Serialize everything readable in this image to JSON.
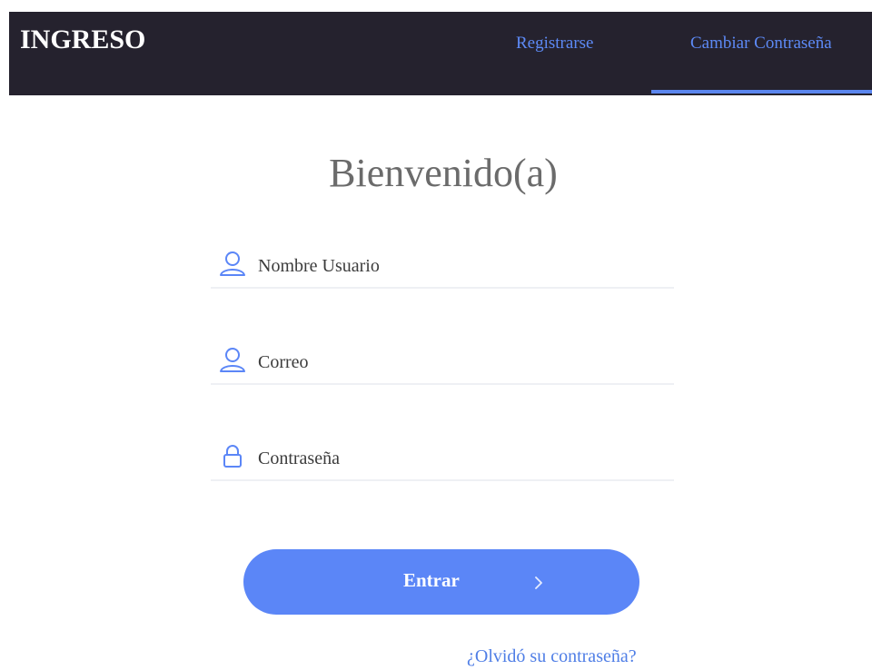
{
  "header": {
    "brand": "INGRESO",
    "nav": {
      "register": "Registrarse",
      "change_password": "Cambiar Contraseña"
    },
    "active_tab": "change_password"
  },
  "main": {
    "welcome": "Bienvenido(a)",
    "fields": {
      "username": {
        "placeholder": "Nombre Usuario",
        "value": "",
        "icon": "user-icon"
      },
      "email": {
        "placeholder": "Correo",
        "value": "",
        "icon": "user-icon"
      },
      "password": {
        "placeholder": "Contraseña",
        "value": "",
        "icon": "lock-icon"
      }
    },
    "submit": {
      "label": "Entrar",
      "icon": "chevron-right-icon"
    },
    "forgot_password": "¿Olvidó su contraseña?"
  },
  "colors": {
    "header_bg": "#25222e",
    "accent": "#5b86f7",
    "link": "#5d8af6",
    "welcome_text": "#6b6b6b",
    "field_border": "#eef0f4"
  }
}
